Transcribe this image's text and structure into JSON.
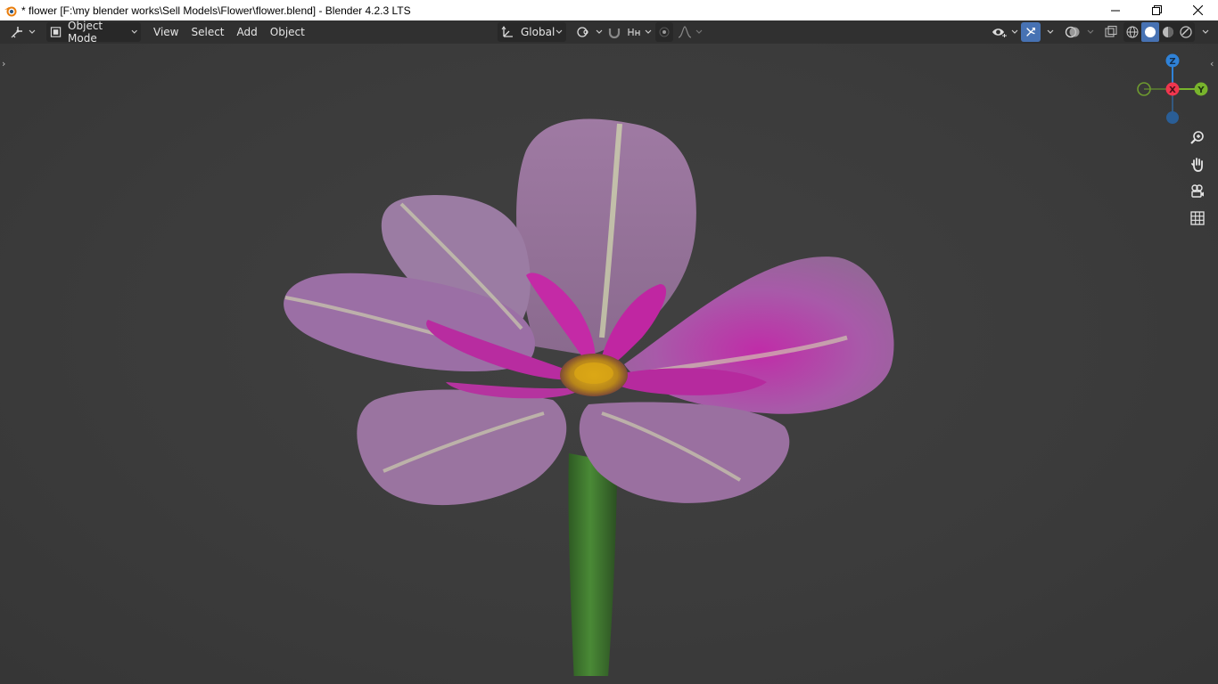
{
  "window": {
    "title": "* flower [F:\\my blender works\\Sell Models\\Flower\\flower.blend] - Blender 4.2.3 LTS",
    "app_icon": "blender-logo-icon",
    "controls": [
      "minimize-icon",
      "restore-icon",
      "close-icon"
    ]
  },
  "header": {
    "editor_type_icon": "3d-viewport-icon",
    "mode": "Object Mode",
    "menus": [
      "View",
      "Select",
      "Add",
      "Object"
    ],
    "orientation": "Global",
    "pivot_icon": "pivot-point-icon",
    "snap_icon": "magnet-icon",
    "snap_target_icon": "snap-increment-icon",
    "proportional_icon": "proportional-edit-icon",
    "falloff_icon": "falloff-curve-icon",
    "visibility_icon": "eye-icon",
    "gizmo_icon": "gizmo-icon",
    "overlay_icon": "overlay-icon",
    "xray_icon": "xray-icon",
    "shading_modes": [
      "wireframe",
      "solid",
      "material-preview",
      "rendered"
    ],
    "active_shading": "solid"
  },
  "viewport": {
    "background_color": "#3d3d3d",
    "object": "flower",
    "petal_color": "#b04fb0",
    "stem_color": "#3f7a2e",
    "center_color": "#d9a514"
  },
  "gizmo": {
    "z_label": "Z",
    "x_label": "X",
    "y_label": "Y",
    "x_color": "#f0364e",
    "y_color": "#78b42c",
    "z_color": "#2f82d8"
  },
  "navigation": [
    "zoom-icon",
    "pan-hand-icon",
    "camera-view-icon",
    "orthographic-grid-icon"
  ]
}
